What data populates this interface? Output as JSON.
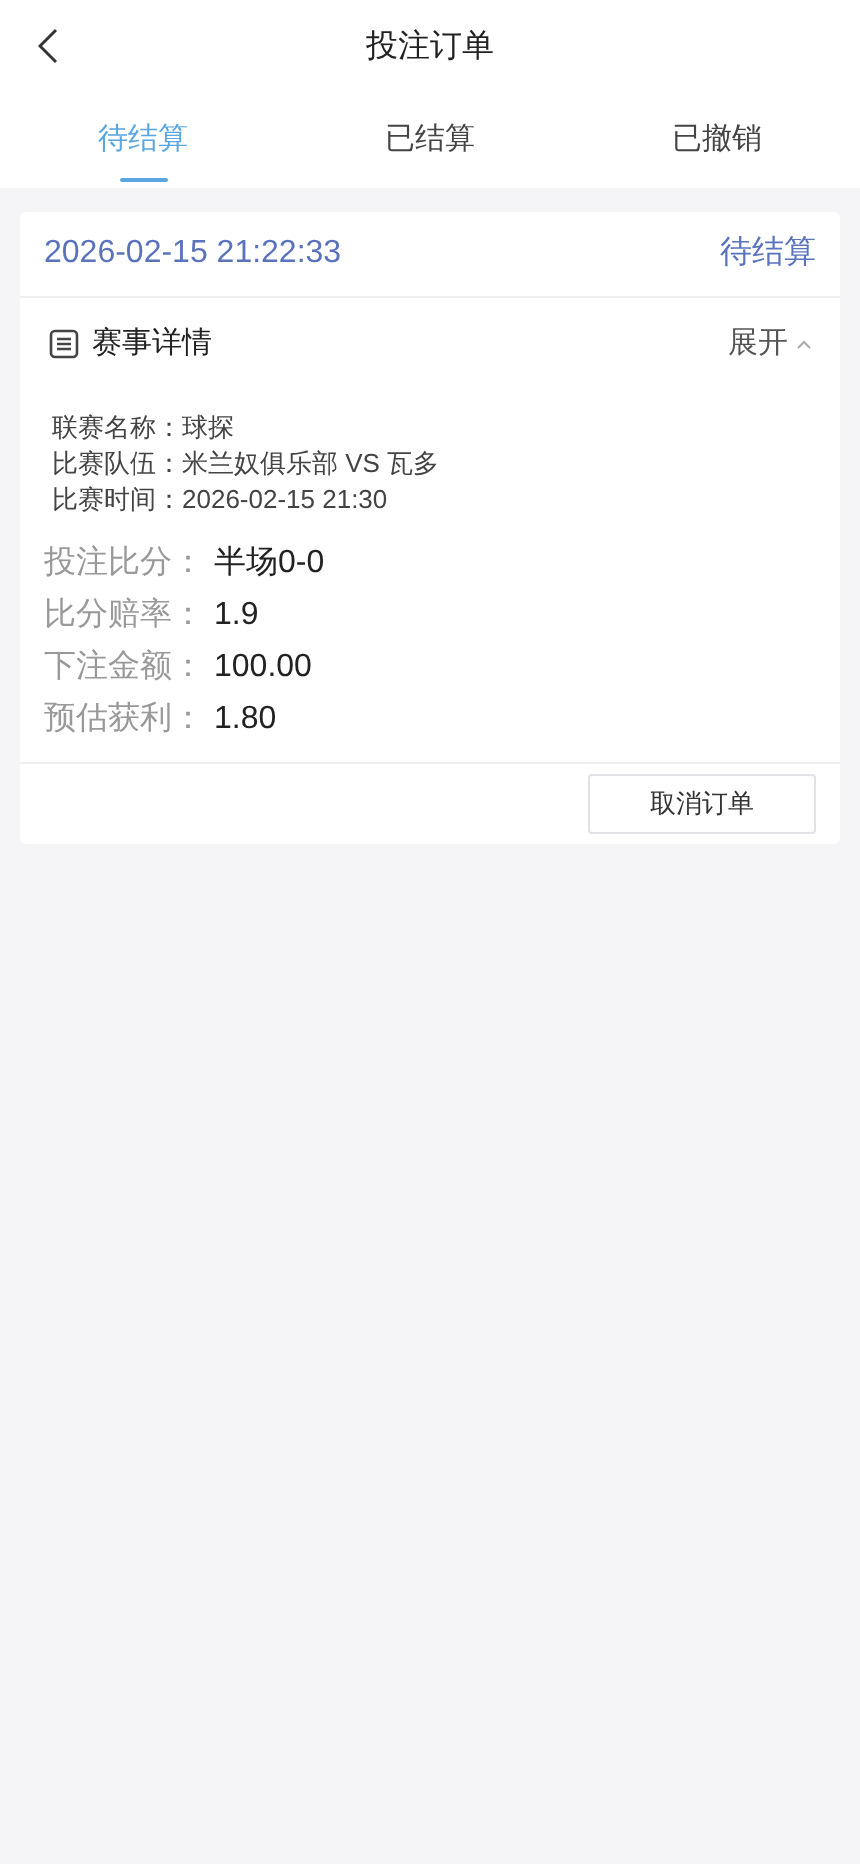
{
  "header": {
    "title": "投注订单"
  },
  "tabs": [
    {
      "label": "待结算",
      "selected": true
    },
    {
      "label": "已结算",
      "selected": false
    },
    {
      "label": "已撤销",
      "selected": false
    }
  ],
  "order": {
    "time": "2026-02-15 21:22:33",
    "status": "待结算",
    "details": {
      "title": "赛事详情",
      "toggle": "展开",
      "info": [
        {
          "label": "联赛名称：",
          "value": "球探"
        },
        {
          "label": "比赛队伍：",
          "value": "米兰奴俱乐部 VS 瓦多"
        },
        {
          "label": "比赛时间：",
          "value": "2026-02-15 21:30"
        }
      ]
    },
    "fields": [
      {
        "label": "投注比分：",
        "value": "半场0-0"
      },
      {
        "label": "比分赔率：",
        "value": "1.9"
      },
      {
        "label": "下注金额：",
        "value": "100.00"
      },
      {
        "label": "预估获利：",
        "value": "1.80"
      }
    ],
    "action": "取消订单"
  }
}
